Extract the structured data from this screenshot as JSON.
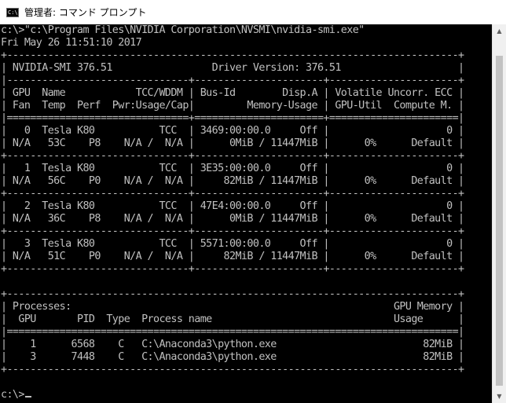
{
  "window": {
    "title": "管理者: コマンド プロンプト",
    "icon": "cmd-icon",
    "icon_glyph": "C:\\"
  },
  "console": {
    "lines": [
      "c:\\>\"c:\\Program Files\\NVIDIA Corporation\\NVSMI\\nvidia-smi.exe\"",
      "Fri May 26 11:51:10 2017",
      "+-----------------------------------------------------------------------------+",
      "| NVIDIA-SMI 376.51                 Driver Version: 376.51                    |",
      "|-------------------------------+----------------------+----------------------+",
      "| GPU  Name            TCC/WDDM | Bus-Id        Disp.A | Volatile Uncorr. ECC |",
      "| Fan  Temp  Perf  Pwr:Usage/Cap|         Memory-Usage | GPU-Util  Compute M. |",
      "|===============================+======================+======================|",
      "|   0  Tesla K80           TCC  | 3469:00:00.0     Off |                    0 |",
      "| N/A   53C    P8    N/A /  N/A |      0MiB / 11447MiB |      0%      Default |",
      "+-------------------------------+----------------------+----------------------+",
      "|   1  Tesla K80           TCC  | 3E35:00:00.0     Off |                    0 |",
      "| N/A   56C    P0    N/A /  N/A |     82MiB / 11447MiB |      0%      Default |",
      "+-------------------------------+----------------------+----------------------+",
      "|   2  Tesla K80           TCC  | 47E4:00:00.0     Off |                    0 |",
      "| N/A   36C    P8    N/A /  N/A |      0MiB / 11447MiB |      0%      Default |",
      "+-------------------------------+----------------------+----------------------+",
      "|   3  Tesla K80           TCC  | 5571:00:00.0     Off |                    0 |",
      "| N/A   51C    P0    N/A /  N/A |     82MiB / 11447MiB |      0%      Default |",
      "+-------------------------------+----------------------+----------------------+",
      "",
      "+-----------------------------------------------------------------------------+",
      "| Processes:                                                       GPU Memory |",
      "|  GPU       PID  Type  Process name                               Usage      |",
      "|=============================================================================|",
      "|    1      6568    C   C:\\Anaconda3\\python.exe                         82MiB |",
      "|    3      7448    C   C:\\Anaconda3\\python.exe                         82MiB |",
      "+-----------------------------------------------------------------------------+",
      "",
      "c:\\>"
    ]
  },
  "scrollbar": {
    "up_glyph": "▲",
    "down_glyph": "▼"
  }
}
